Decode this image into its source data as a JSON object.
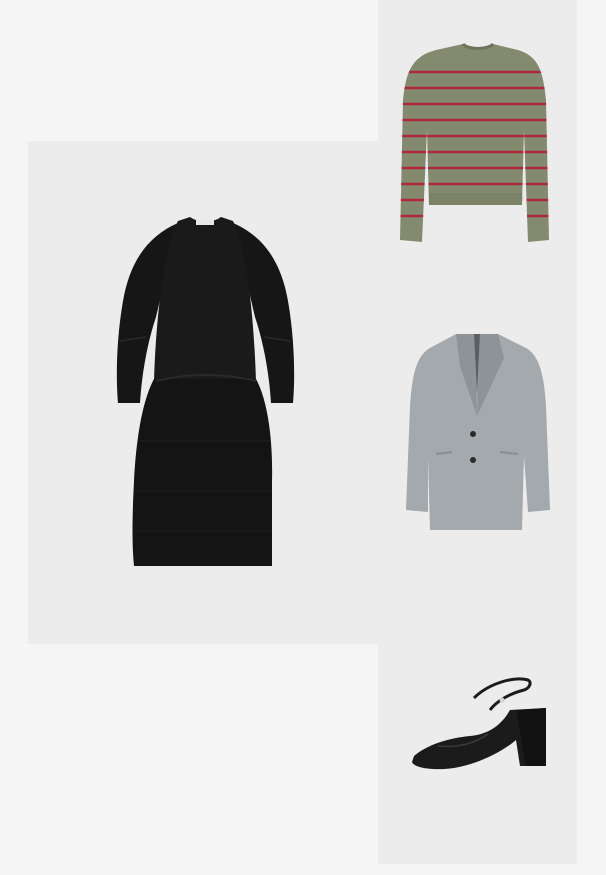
{
  "collage": {
    "background_color": "#f5f5f5",
    "tile_color": "#ececec",
    "items": [
      {
        "icon": "black-dress-icon",
        "color": "#161616"
      },
      {
        "icon": "striped-sweater-icon",
        "color": "#848a6e",
        "stripe_color": "#b0283e"
      },
      {
        "icon": "grey-blazer-icon",
        "color": "#a3a9ad"
      },
      {
        "icon": "black-heel-icon",
        "color": "#1b1b1b"
      }
    ]
  }
}
